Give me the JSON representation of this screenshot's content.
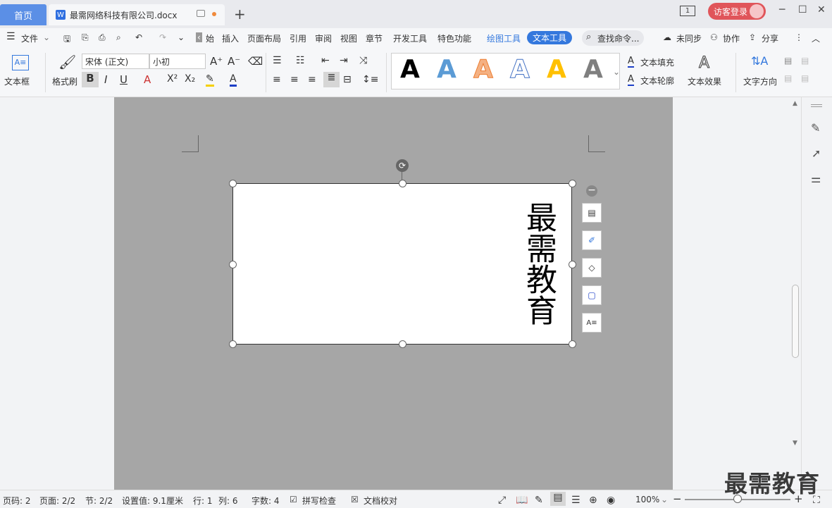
{
  "titlebar": {
    "home_tab": "首页",
    "doc_tab": "最需网络科技有限公司.docx",
    "login": "访客登录",
    "page_indicator": "1"
  },
  "menu": {
    "file": "文件",
    "items": [
      "始",
      "插入",
      "页面布局",
      "引用",
      "审阅",
      "视图",
      "章节",
      "开发工具",
      "特色功能"
    ],
    "drawing_tools": "绘图工具",
    "text_tools": "文本工具",
    "search": "查找命令...",
    "unsynced": "未同步",
    "collaborate": "协作",
    "share": "分享"
  },
  "ribbon": {
    "textbox": "文本框",
    "format_painter": "格式刷",
    "font_name": "宋体 (正文)",
    "font_size": "小初",
    "text_fill": "文本填充",
    "text_outline": "文本轮廓",
    "text_effect": "文本效果",
    "text_direction": "文字方向",
    "style_letter": "A"
  },
  "document": {
    "text": "最需教育"
  },
  "status": {
    "page_no": "页码: 2",
    "page": "页面: 2/2",
    "section": "节: 2/2",
    "setting": "设置值: 9.1厘米",
    "row": "行: 1",
    "col": "列: 6",
    "words": "字数: 4",
    "spellcheck": "拼写检查",
    "proof": "文档校对",
    "zoom": "100%"
  },
  "watermark": "最需教育",
  "colors": {
    "accent": "#3478dd",
    "login": "#e0555a"
  }
}
